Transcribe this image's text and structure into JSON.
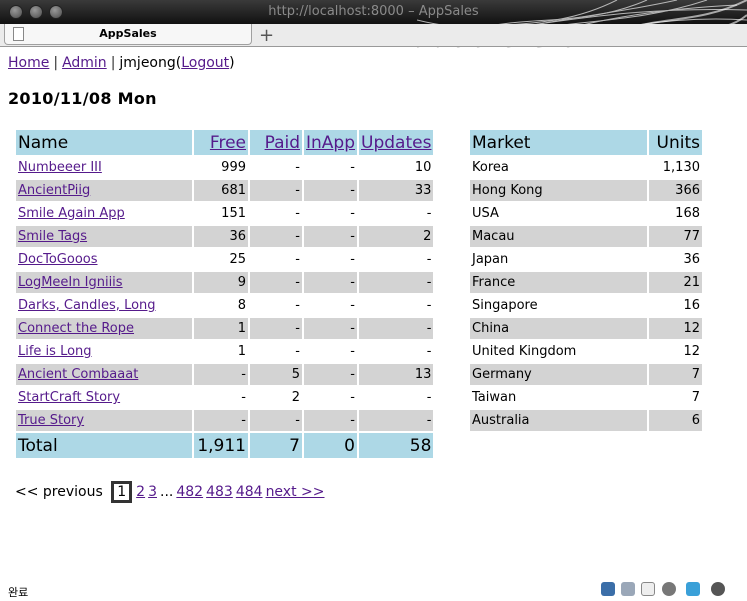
{
  "window": {
    "title": "http://localhost:8000 – AppSales"
  },
  "tab": {
    "label": "AppSales",
    "new_tab": "+"
  },
  "nav": {
    "home": "Home",
    "admin": "Admin",
    "user": "jmjeong",
    "logout": "Logout"
  },
  "date": "2010/11/08 Mon",
  "apps_table": {
    "headers": [
      "Name",
      "Free",
      "Paid",
      "InApp",
      "Updates"
    ],
    "rows": [
      [
        "Numbeeer III",
        "999",
        "-",
        "-",
        "10"
      ],
      [
        "AncientPiig",
        "681",
        "-",
        "-",
        "33"
      ],
      [
        "Smile Again App",
        "151",
        "-",
        "-",
        "-"
      ],
      [
        "Smile Tags",
        "36",
        "-",
        "-",
        "2"
      ],
      [
        "DocToGooos",
        "25",
        "-",
        "-",
        "-"
      ],
      [
        "LogMeeIn Igniiis",
        "9",
        "-",
        "-",
        "-"
      ],
      [
        "Darks, Candles, Long",
        "8",
        "-",
        "-",
        "-"
      ],
      [
        "Connect the Rope",
        "1",
        "-",
        "-",
        "-"
      ],
      [
        "Life is Long",
        "1",
        "-",
        "-",
        "-"
      ],
      [
        "Ancient Combaaat",
        "-",
        "5",
        "-",
        "13"
      ],
      [
        "StartCraft Story",
        "-",
        "2",
        "-",
        "-"
      ],
      [
        "True Story",
        "-",
        "-",
        "-",
        "-"
      ]
    ],
    "total": [
      "Total",
      "1,911",
      "7",
      "0",
      "58"
    ]
  },
  "market_table": {
    "headers": [
      "Market",
      "Units"
    ],
    "rows": [
      [
        "Korea",
        "1,130"
      ],
      [
        "Hong Kong",
        "366"
      ],
      [
        "USA",
        "168"
      ],
      [
        "Macau",
        "77"
      ],
      [
        "Japan",
        "36"
      ],
      [
        "France",
        "21"
      ],
      [
        "Singapore",
        "16"
      ],
      [
        "China",
        "12"
      ],
      [
        "United Kingdom",
        "12"
      ],
      [
        "Germany",
        "7"
      ],
      [
        "Taiwan",
        "7"
      ],
      [
        "Australia",
        "6"
      ]
    ]
  },
  "pager": {
    "previous": "<< previous",
    "current": "1",
    "pages": [
      "2",
      "3"
    ],
    "ellipsis": "...",
    "tail_pages": [
      "482",
      "483",
      "484"
    ],
    "next": "next >>"
  },
  "status": {
    "text": "완료"
  },
  "status_icons": [
    "window-icon",
    "puzzle-icon",
    "mail-icon",
    "speech-icon",
    "yslow-icon",
    "bug-icon"
  ]
}
